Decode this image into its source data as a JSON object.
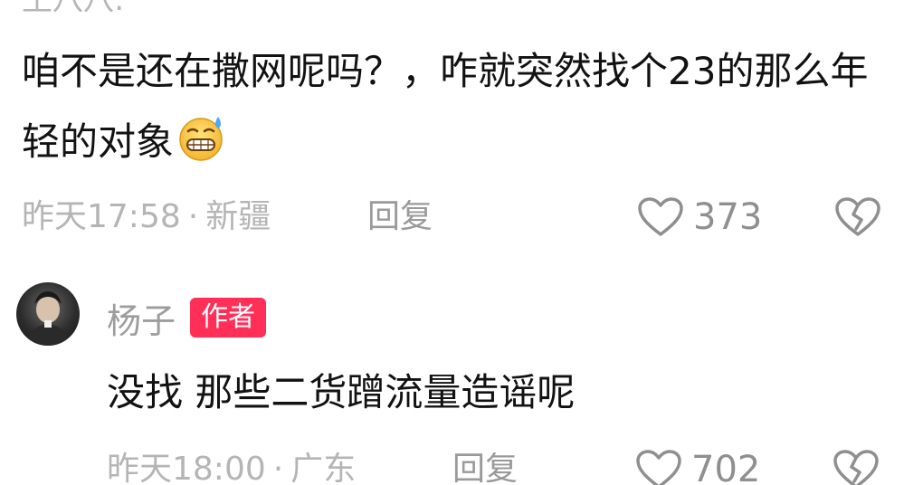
{
  "top": {
    "username_partial": "王八八:"
  },
  "comment1": {
    "text": "咱不是还在撒网呢吗？，咋就突然找个23的那么年轻的对象",
    "emoji": "grimacing-sweat-emoji",
    "time": "昨天17:58",
    "separator": "·",
    "location": "新疆",
    "reply_label": "回复",
    "likes": "373"
  },
  "comment2": {
    "username": "杨子",
    "badge": "作者",
    "text": "没找 那些二货蹭流量造谣呢",
    "time": "昨天18:00",
    "separator": "·",
    "location": "广东",
    "reply_label": "回复",
    "likes": "702"
  },
  "colors": {
    "badge_bg": "#ff2f58",
    "meta_text": "#b5b5b5",
    "body_text": "#121212"
  }
}
